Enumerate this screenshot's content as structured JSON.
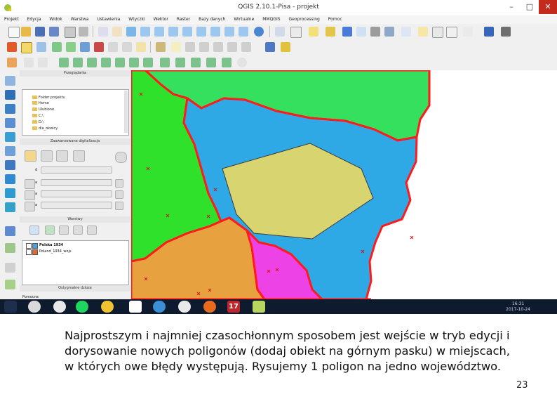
{
  "window": {
    "title": "QGIS 2.10.1-Pisa - projekt",
    "minimize_glyph": "–",
    "maximize_glyph": "□",
    "close_glyph": "✕"
  },
  "menu": [
    "Projekt",
    "Edycja",
    "Widok",
    "Warstwa",
    "Ustawienia",
    "Wtyczki",
    "Wektor",
    "Raster",
    "Bazy danych",
    "Wirtualne",
    "MMQGIS",
    "Geoprocessing",
    "Pomoc"
  ],
  "panels": {
    "browser_title": "Przeglądarka",
    "browser_items": [
      "Folder projektu",
      "Home",
      "Ulubione",
      "C:\\",
      "D:\\",
      "dla_okwicy"
    ],
    "digitizing_title": "Zaawansowane digitalizacja",
    "digitizing_fields": [
      "d",
      "a",
      "a",
      "a"
    ],
    "layers_title": "Warstwy",
    "layers": [
      "Polska 1934",
      "Poland_1934_wojs"
    ],
    "layers_sort_title": "Ostygmalne dzioze",
    "bottom_label": "Pomocna"
  },
  "taskbar": {
    "tray_time": "16:31",
    "tray_date": "2017-10-24",
    "taskbar_badge_17": "17"
  },
  "colors": {
    "green_region": "#35e05e",
    "lime_region": "#2fe12a",
    "blue_region": "#2fa9e6",
    "khaki_region": "#d8d470",
    "orange_region": "#e7a13f",
    "magenta_region": "#ec42e6",
    "border_red": "#ff1b1b",
    "title_bar_bg": "#ffffff",
    "taskbar_bg": "#0e1a2e"
  },
  "caption": {
    "text": "Najprostszym i najmniej czasochłonnym sposobem jest wejście w tryb edycji i dorysowanie nowych poligonów (dodaj obiekt na górnym pasku) w miejscach, w których owe błędy występują. Rysujemy 1 poligon na jedno województwo.",
    "page_number": "23"
  }
}
